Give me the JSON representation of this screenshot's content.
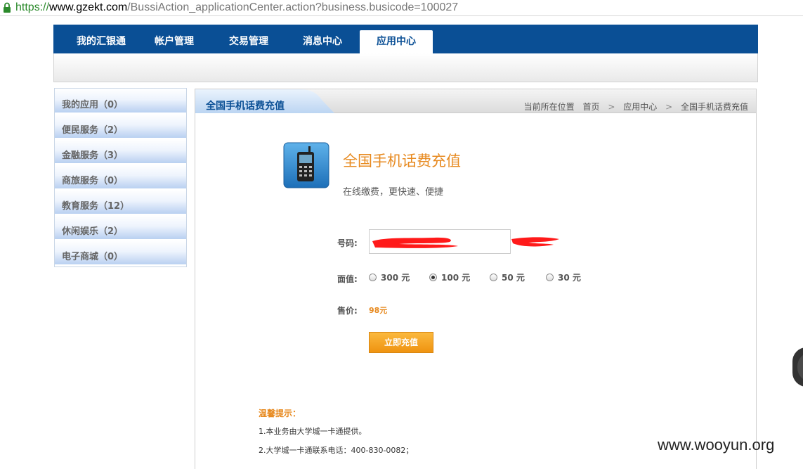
{
  "browser": {
    "url_scheme": "https://",
    "url_host": "www.gzekt.com",
    "url_path": "/BussiAction_applicationCenter.action?business.busicode=100027"
  },
  "top_nav": {
    "tabs": [
      {
        "label": "我的汇银通",
        "active": false
      },
      {
        "label": "帐户管理",
        "active": false
      },
      {
        "label": "交易管理",
        "active": false
      },
      {
        "label": "消息中心",
        "active": false
      },
      {
        "label": "应用中心",
        "active": true
      }
    ]
  },
  "sidebar": {
    "items": [
      {
        "label": "我的应用（0）"
      },
      {
        "label": "便民服务（2）"
      },
      {
        "label": "金融服务（3）"
      },
      {
        "label": "商旅服务（0）"
      },
      {
        "label": "教育服务（12）"
      },
      {
        "label": "休闲娱乐（2）"
      },
      {
        "label": "电子商城（0）"
      }
    ]
  },
  "content": {
    "section_title": "全国手机话费充值",
    "breadcrumb": {
      "prefix": "当前所在位置",
      "items": [
        "首页",
        "应用中心",
        "全国手机话费充值"
      ],
      "separator": ">"
    },
    "app": {
      "icon": "mobile-phone-icon",
      "title": "全国手机话费充值",
      "subtitle": "在线缴费，更快速、便捷"
    },
    "form": {
      "phone_label": "号码:",
      "amount_label": "面值:",
      "amount_options": [
        {
          "label": "300 元",
          "checked": false
        },
        {
          "label": "100 元",
          "checked": true
        },
        {
          "label": "50 元",
          "checked": false
        },
        {
          "label": "30 元",
          "checked": false
        }
      ],
      "price_label": "售价:",
      "price_value": "98元",
      "submit_label": "立即充值"
    },
    "tips": {
      "heading": "温馨提示：",
      "items": [
        "1.本业务由大学城一卡通提供。",
        "2.大学城一卡通联系电话：400-830-0082；"
      ]
    }
  },
  "colors": {
    "nav_blue": "#0a4f95",
    "accent_orange": "#e78a20",
    "redaction_red": "#ff1a1a"
  },
  "watermark": "www.wooyun.org"
}
